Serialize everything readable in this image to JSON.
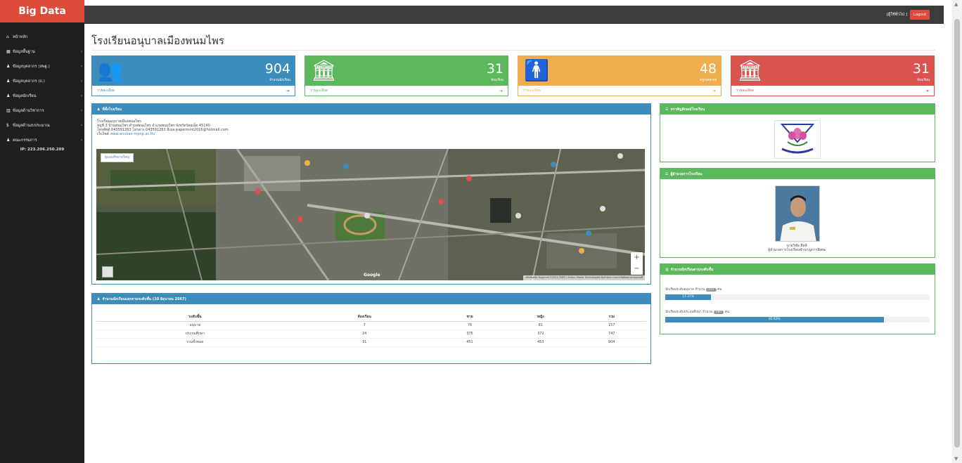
{
  "sidebar": {
    "brand": "Big Data",
    "items": [
      {
        "icon": "home-icon",
        "glyph": "⌂",
        "label": "หน้าหลัก",
        "chevron": false
      },
      {
        "icon": "table-icon",
        "glyph": "▦",
        "label": "ข้อมูลพื้นฐาน",
        "chevron": true
      },
      {
        "icon": "user-icon",
        "glyph": "♟",
        "label": "ข้อมูลบุคลากร (สพฐ.)",
        "chevron": true
      },
      {
        "icon": "user-icon",
        "glyph": "♟",
        "label": "ข้อมูลบุคลากร (ถ.)",
        "chevron": true
      },
      {
        "icon": "user-icon",
        "glyph": "♟",
        "label": "ข้อมูลนักเรียน",
        "chevron": true
      },
      {
        "icon": "bar-chart-icon",
        "glyph": "▥",
        "label": "ข้อมูลด้านวิชาการ",
        "chevron": true
      },
      {
        "icon": "dollar-icon",
        "glyph": "$",
        "label": "ข้อมูลด้านงบประมาณ",
        "chevron": true
      },
      {
        "icon": "user-icon",
        "glyph": "♟",
        "label": "คณะกรรมการ",
        "chevron": true
      }
    ],
    "ip": "IP: 223.206.250.209"
  },
  "topbar": {
    "user": "[ผู้ใช้ทั่วไป ]",
    "logout": "Logout"
  },
  "page_title": "โรงเรียนอนุบาลเมืองพนมไพร",
  "stats": [
    {
      "value": "904",
      "label": "จำนวนนักเรียน",
      "link": "รายละเอียด",
      "color": "#3c8dbc",
      "icon": "users-icon",
      "glyph": "👥"
    },
    {
      "value": "31",
      "label": "ห้องเรียน",
      "link": "รายละเอียด",
      "color": "#5cb85c",
      "icon": "building-icon",
      "glyph": "🏛"
    },
    {
      "value": "48",
      "label": "ครู/บุคลากร",
      "link": "รายละเอียด",
      "color": "#f0ad4e",
      "icon": "person-icon",
      "glyph": "🚹"
    },
    {
      "value": "31",
      "label": "ห้องเรียน",
      "link": "รายละเอียด",
      "color": "#d9534f",
      "icon": "building-icon",
      "glyph": "🏛"
    }
  ],
  "location": {
    "title": "ที่ตั้งโรงเรียน",
    "lines": [
      "โรงเรียนอนุบาลเมืองพนมไพร",
      "หมู่ที่ 3 บ้านพนมไพร ตำบลพนมไพร อำเภอพนมไพร จังหวัดร้อยเอ็ด 45140",
      "โทรศัพท์ 043591263 โทรสาร 043591263 อีเมล papermint2016@hotmail.com"
    ],
    "site_label": "เว็บไซต์",
    "site_url": "www.anuban-mpnp.ac.th/",
    "map_button": "ดูแผนที่ขยายใหญ่",
    "google": "Google",
    "zoom_in": "+",
    "zoom_out": "−",
    "attribution": "แป้นพิมพ์ลัด  ข้อมูลภาพ ©2024 CNES / Airbus, Maxar Technologies  ข้อกำหนด  รายงานข้อผิดพลาดของแผนที่"
  },
  "class_table": {
    "title": "จำนวนนักเรียนแยกตามระดับชั้น (10 มิถุนายน 2567)",
    "headers": [
      "ระดับชั้น",
      "ห้องเรียน",
      "ชาย",
      "หญิง",
      "รวม"
    ],
    "rows": [
      [
        "อนุบาล",
        "7",
        "76",
        "81",
        "157"
      ],
      [
        "ประถมศึกษา",
        "24",
        "375",
        "372",
        "747"
      ],
      [
        "รวมทั้งหมด",
        "31",
        "451",
        "453",
        "904"
      ]
    ]
  },
  "emblem_panel": {
    "title": "ตราสัญลักษณ์โรงเรียน",
    "caption": "โรงเรียนอนุบาลเมืองพนมไพร"
  },
  "director_panel": {
    "title": "ผู้อำนวยการโรงเรียน",
    "name": "นายวิชัย สีหลี",
    "position": "ผู้อำนวยการโรงเรียนชำนาญการพิเศษ"
  },
  "levels_panel": {
    "title": "จำนวนนักเรียนตามระดับชั้น",
    "bars": [
      {
        "prefix": "นักเรียนระดับอนุบาล จำนวน",
        "count": "157",
        "suffix": "คน",
        "percent_label": "17.37%",
        "fraction": 0.1737
      },
      {
        "prefix": "นักเรียนระดับประถมศึกษา จำนวน",
        "count": "747",
        "suffix": "คน",
        "percent_label": "82.63%",
        "fraction": 0.8263
      }
    ]
  }
}
